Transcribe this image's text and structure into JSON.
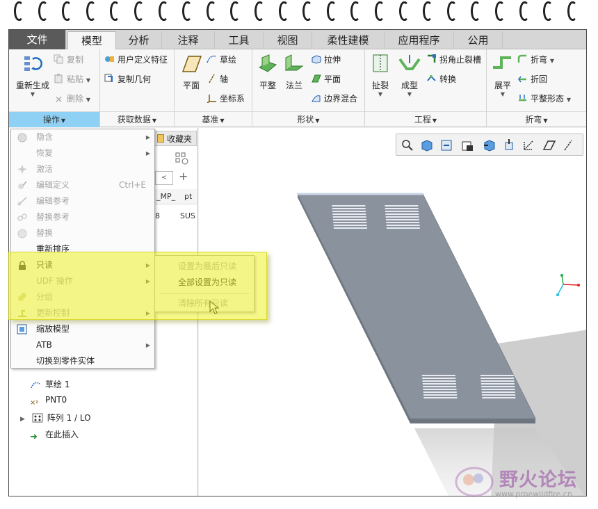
{
  "tabs": [
    "文件",
    "模型",
    "分析",
    "注释",
    "工具",
    "视图",
    "柔性建模",
    "应用程序",
    "公用"
  ],
  "active_tab": "模型",
  "ribbon": {
    "operations": {
      "regenerate": "重新生成",
      "copy": "复制",
      "paste": "粘贴",
      "delete": "删除",
      "label": "操作"
    },
    "get_data": {
      "udf": "用户定义特征",
      "copy_geom": "复制几何",
      "label": "获取数据"
    },
    "datum": {
      "plane": "平面",
      "sketch": "草绘",
      "axis": "轴",
      "csys": "坐标系",
      "label": "基准"
    },
    "shapes": {
      "flat": "平整",
      "flange": "法兰",
      "extrude": "拉伸",
      "planar": "平面",
      "boundary_blend": "边界混合",
      "label": "形状"
    },
    "engineering": {
      "rip": "扯裂",
      "form": "成型",
      "corner_relief": "拐角止裂槽",
      "convert": "转换",
      "label": "工程"
    },
    "bends": {
      "unbend": "展平",
      "bend": "折弯",
      "bend_back": "折回",
      "flat_state": "平整形态",
      "label": "折弯"
    }
  },
  "context_menu": {
    "items": [
      {
        "label": "隐含",
        "disabled": true,
        "submenu": true
      },
      {
        "label": "恢复",
        "disabled": true,
        "submenu": true
      },
      {
        "label": "激活",
        "disabled": true
      },
      {
        "label": "编辑定义",
        "disabled": true,
        "shortcut": "Ctrl+E"
      },
      {
        "label": "编辑参考",
        "disabled": true
      },
      {
        "label": "替换参考",
        "disabled": true
      },
      {
        "label": "替换",
        "disabled": true
      },
      {
        "label": "重新排序",
        "disabled": false
      },
      {
        "label": "只读",
        "disabled": false,
        "submenu": true
      },
      {
        "label": "UDF 操作",
        "disabled": true,
        "submenu": true
      },
      {
        "label": "分组",
        "disabled": true
      },
      {
        "label": "更新控制",
        "disabled": true,
        "submenu": true
      },
      {
        "label": "缩放模型",
        "disabled": false
      },
      {
        "label": "ATB",
        "disabled": false,
        "submenu": true
      },
      {
        "label": "切换到零件实体",
        "disabled": false
      }
    ]
  },
  "submenu_readonly": {
    "items": [
      {
        "label": "设置为最后只读",
        "disabled": true
      },
      {
        "label": "全部设置为只读",
        "disabled": false
      },
      {
        "label": "清除所有只读",
        "disabled": true
      }
    ]
  },
  "tree": {
    "fav_tab": "收藏夹",
    "col1": "_MP_",
    "col2": "pt",
    "cell1": "8",
    "cell2": "SUS",
    "rows": [
      {
        "label": "草绘 1"
      },
      {
        "label": "PNT0"
      },
      {
        "label": "阵列 1 / LO"
      },
      {
        "label": "在此插入"
      }
    ]
  },
  "watermark": {
    "text": "野火论坛",
    "url": "www.proewildfire.cn"
  },
  "colors": {
    "selected_group": "#8fd0f5",
    "highlight": "#eef028",
    "part": "#8a929e"
  }
}
